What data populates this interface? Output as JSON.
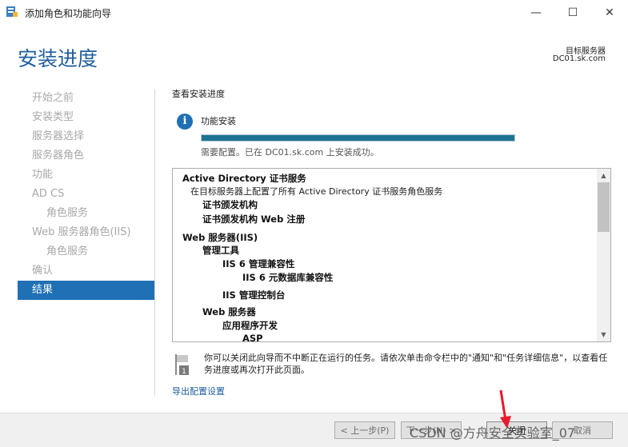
{
  "window": {
    "title": "添加角色和功能向导",
    "minimize_icon": "—",
    "maximize_icon": "☐",
    "close_icon": "✕"
  },
  "header": {
    "page_title": "安装进度",
    "target_label": "目标服务器",
    "target_name": "DC01.sk.com"
  },
  "sidebar": {
    "items": [
      {
        "label": "开始之前",
        "sub": false,
        "active": false
      },
      {
        "label": "安装类型",
        "sub": false,
        "active": false
      },
      {
        "label": "服务器选择",
        "sub": false,
        "active": false
      },
      {
        "label": "服务器角色",
        "sub": false,
        "active": false
      },
      {
        "label": "功能",
        "sub": false,
        "active": false
      },
      {
        "label": "AD CS",
        "sub": false,
        "active": false
      },
      {
        "label": "角色服务",
        "sub": true,
        "active": false
      },
      {
        "label": "Web 服务器角色(IIS)",
        "sub": false,
        "active": false
      },
      {
        "label": "角色服务",
        "sub": true,
        "active": false
      },
      {
        "label": "确认",
        "sub": false,
        "active": false
      },
      {
        "label": "结果",
        "sub": false,
        "active": true
      }
    ]
  },
  "main": {
    "section_label": "查看安装进度",
    "info_icon": "i",
    "status_title": "功能安装",
    "progress": 1.0,
    "status_message": "需要配置。已在 DC01.sk.com 上安装成功。",
    "results": [
      {
        "text": "Active Directory 证书服务",
        "bold": true,
        "indent": 0
      },
      {
        "text": "在目标服务器上配置了所有 Active Directory 证书服务角色服务",
        "bold": false,
        "indent": 1
      },
      {
        "text": "证书颁发机构",
        "bold": true,
        "indent": 2
      },
      {
        "text": "证书颁发机构 Web 注册",
        "bold": true,
        "indent": 2
      },
      {
        "text": "Web 服务器(IIS)",
        "bold": true,
        "indent": 0
      },
      {
        "text": "管理工具",
        "bold": true,
        "indent": 2
      },
      {
        "text": "IIS 6 管理兼容性",
        "bold": true,
        "indent": 3
      },
      {
        "text": "IIS 6 元数据库兼容性",
        "bold": true,
        "indent": 4
      },
      {
        "text": "IIS 管理控制台",
        "bold": true,
        "indent": 3
      },
      {
        "text": "Web 服务器",
        "bold": true,
        "indent": 2
      },
      {
        "text": "应用程序开发",
        "bold": true,
        "indent": 3
      },
      {
        "text": "ASP",
        "bold": true,
        "indent": 4
      }
    ],
    "scroll_up": "▲",
    "scroll_down": "▼",
    "note_text": "你可以关闭此向导而不中断正在运行的任务。请依次单击命令栏中的\"通知\"和\"任务详细信息\"，以查看任务进度或再次打开此页面。",
    "note_icon_number": "1",
    "export_link": "导出配置设置"
  },
  "footer": {
    "prev_label": "< 上一步(P)",
    "next_label": "下一步(N) >",
    "close_label": "关闭",
    "cancel_label": "取消"
  },
  "overlay": {
    "watermark": "CSDN @方舟安全实验室_07",
    "arrow_color": "#e8192c"
  }
}
